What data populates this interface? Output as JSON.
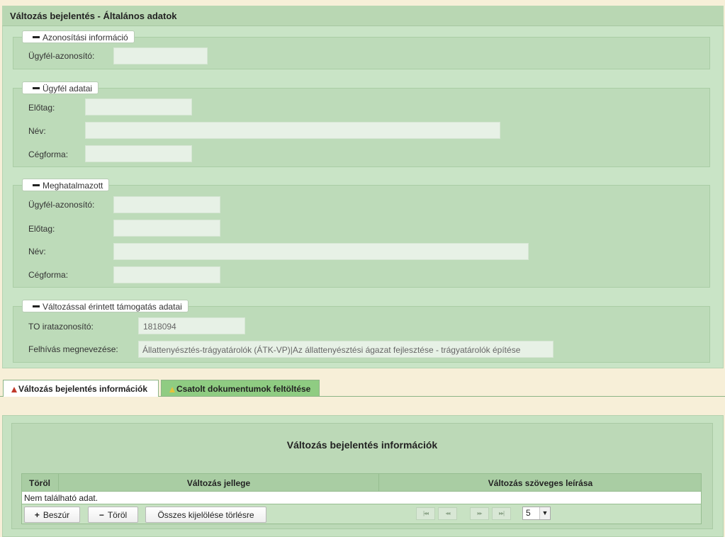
{
  "header": {
    "title": "Változás bejelentés - Általános adatok"
  },
  "sections": {
    "azonositasi": {
      "legend": "Azonosítási információ",
      "fields": [
        {
          "label": "Ügyfél-azonosító:",
          "value": ""
        }
      ]
    },
    "ugyfel": {
      "legend": "Ügyfél adatai",
      "fields": [
        {
          "label": "Előtag:",
          "value": ""
        },
        {
          "label": "Név:",
          "value": ""
        },
        {
          "label": "Cégforma:",
          "value": ""
        }
      ]
    },
    "meghatalmazott": {
      "legend": "Meghatalmazott",
      "fields": [
        {
          "label": "Ügyfél-azonosító:",
          "value": ""
        },
        {
          "label": "Előtag:",
          "value": ""
        },
        {
          "label": "Név:",
          "value": ""
        },
        {
          "label": "Cégforma:",
          "value": ""
        }
      ]
    },
    "tamogatas": {
      "legend": "Változással érintett támogatás adatai",
      "fields": [
        {
          "label": "TO iratazonosító:",
          "value": "1818094"
        },
        {
          "label": "Felhívás megnevezése:",
          "value": "Állattenyésztés-trágyatárolók (ÁTK-VP)|Az állattenyésztési ágazat fejlesztése - trágyatárolók építése"
        }
      ]
    }
  },
  "tabs": [
    {
      "label": "Változás bejelentés információk",
      "active": true,
      "icon": "warning-red-icon"
    },
    {
      "label": "Csatolt dokumentumok feltöltése",
      "active": false,
      "icon": "warning-yellow-icon"
    }
  ],
  "grid": {
    "title": "Változás bejelentés információk",
    "columns": [
      "Töröl",
      "Változás jellege",
      "Változás szöveges leírása"
    ],
    "empty_text": "Nem található adat.",
    "buttons": {
      "insert": "Beszúr",
      "delete": "Töröl",
      "clear_all": "Összes kijelölése törlésre"
    },
    "pager": {
      "page_size": "5",
      "first": "|◂◂",
      "prev": "◂◂",
      "next": "▸▸",
      "last": "▸▸|"
    }
  },
  "colors": {
    "panel_bg": "#c9e4c6",
    "header_bg": "#b9d7b3",
    "fieldset_bg": "#bddbb9",
    "input_bg": "#e7f1e6",
    "active_tab": "#ffffff",
    "inactive_tab": "#8fcc82",
    "page_bg": "#f7efd8"
  }
}
